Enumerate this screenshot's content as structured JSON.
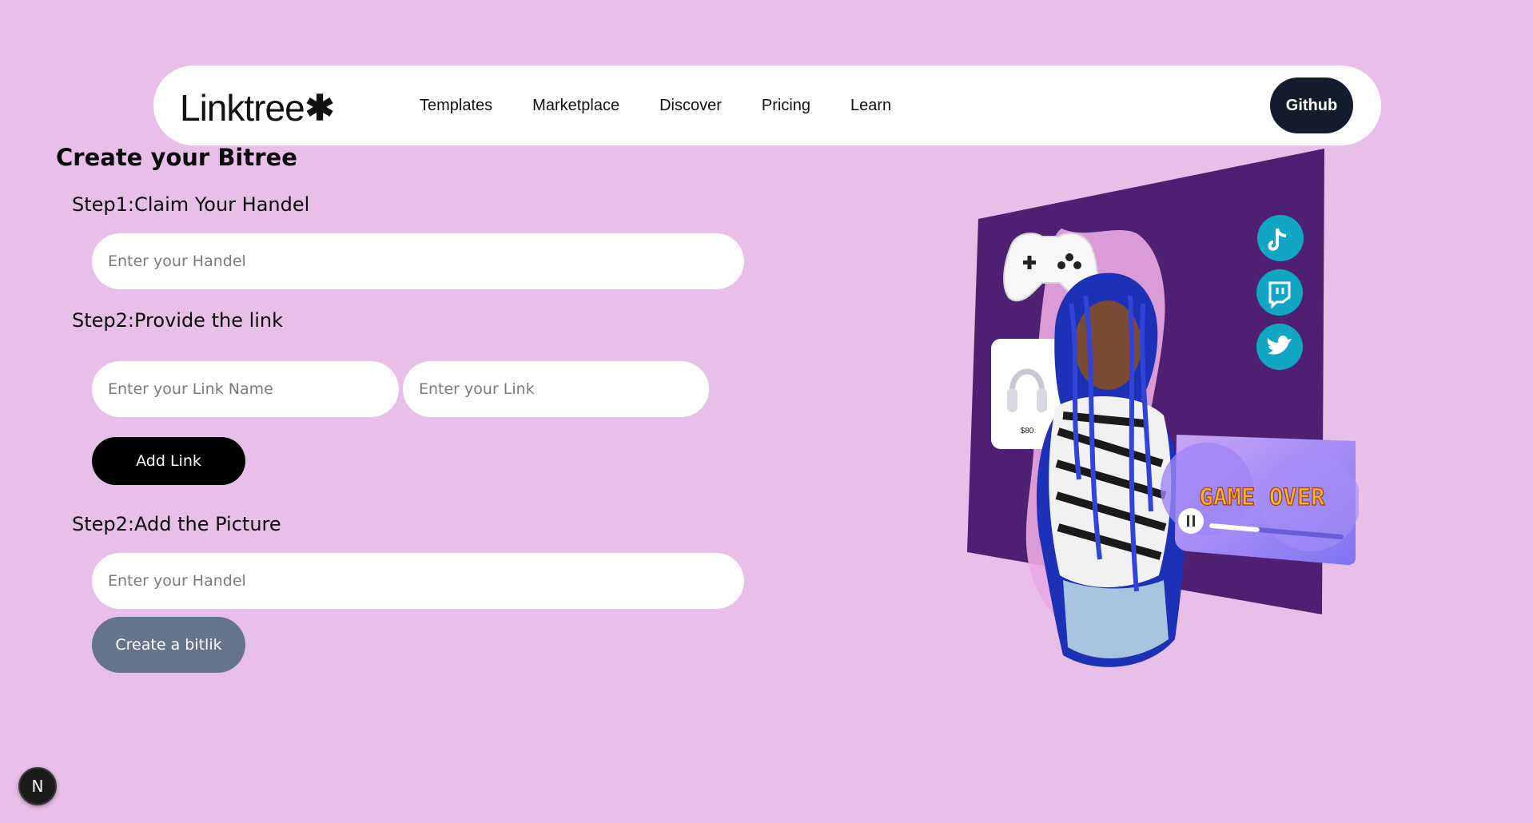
{
  "nav": {
    "logo_text": "Linktree",
    "logo_mark": "✱",
    "links": [
      "Templates",
      "Marketplace",
      "Discover",
      "Pricing",
      "Learn"
    ],
    "github_label": "Github"
  },
  "form": {
    "title": "Create your Bitree",
    "step1_label": "Step1:Claim Your Handel",
    "handle_placeholder": "Enter your Handel",
    "step2_label": "Step2:Provide the link",
    "link_name_placeholder": "Enter your Link Name",
    "link_placeholder": "Enter your Link",
    "add_link_label": "Add Link",
    "step3_label": "Step2:Add the Picture",
    "picture_placeholder": "Enter your Handel",
    "create_label": "Create a bitlik"
  },
  "hero": {
    "price_label": "$80",
    "game_text": "GAME OVER",
    "social_icons": [
      "tiktok-icon",
      "twitch-icon",
      "twitter-icon"
    ],
    "colors": {
      "panel": "#4f1f72",
      "social": "#11a6c4",
      "card_a": "#b79cf7",
      "card_b": "#7f74f2"
    }
  },
  "dev_badge": "N"
}
